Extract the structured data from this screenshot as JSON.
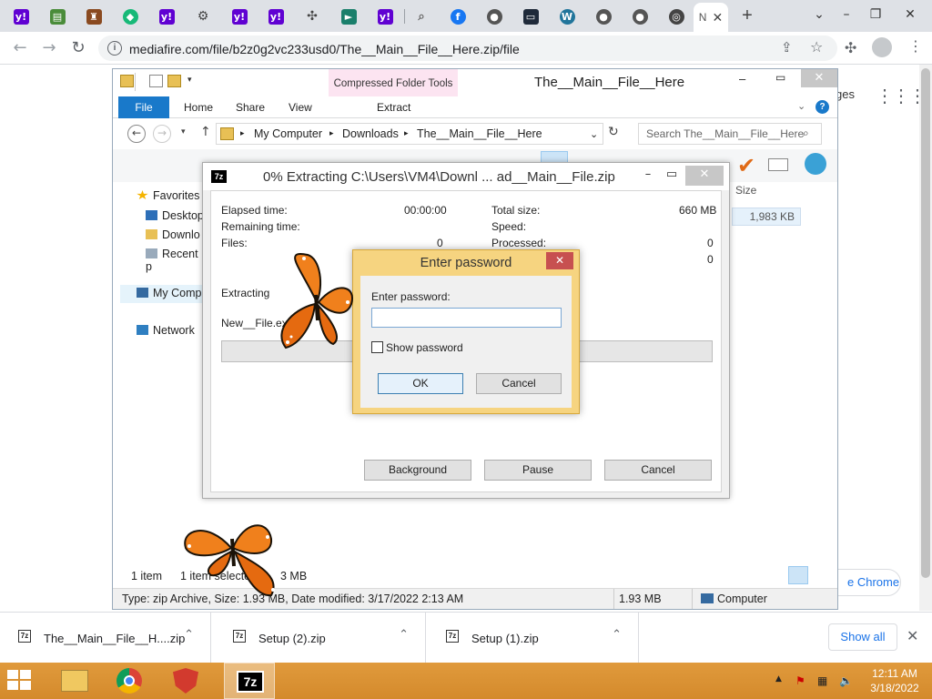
{
  "browser": {
    "tab_icons": [
      "yahoo-icon",
      "game-icon",
      "game2-icon",
      "diamond-icon",
      "yahoo-icon",
      "gear-icon",
      "yahoo-icon",
      "yahoo-icon",
      "puzzle-icon",
      "arrow-icon",
      "yahoo-icon",
      "search-icon",
      "facebook-icon",
      "globe-icon",
      "terminal-icon",
      "wordpress-icon",
      "globe-icon",
      "globe-icon",
      "chrome-icon"
    ],
    "active_tab_label": "N",
    "url": "mediafire.com/file/b2z0g2vc233usd0/The__Main__File__Here.zip/file"
  },
  "page": {
    "partial_text": "ges",
    "chrome_button": "e Chrome"
  },
  "explorer": {
    "title": "The__Main__File__Here",
    "contextual_tab": "Compressed Folder Tools",
    "tabs": [
      "File",
      "Home",
      "Share",
      "View",
      "Extract"
    ],
    "breadcrumb": [
      "My Computer",
      "Downloads",
      "The__Main__File__Here"
    ],
    "search_placeholder": "Search The__Main__File__Here",
    "nav": [
      "Favorites",
      "Desktop",
      "Downlo",
      "Recent p",
      "My Comp",
      "Network"
    ],
    "column_size": "Size",
    "size_value": "1,983 KB",
    "status_count": "1 item",
    "status_selected": "1 item selecte",
    "status_size": "3 MB",
    "details": "Type: zip Archive, Size: 1.93 MB, Date modified: 3/17/2022 2:13 AM",
    "details_size": "1.93 MB",
    "details_location": "Computer"
  },
  "progress": {
    "title": "0% Extracting C:\\Users\\VM4\\Downl ... ad__Main__File.zip",
    "elapsed_label": "Elapsed time:",
    "elapsed_value": "00:00:00",
    "remaining_label": "Remaining time:",
    "files_label": "Files:",
    "files_value": "0",
    "total_size_label": "Total size:",
    "total_size_value": "660 MB",
    "speed_label": "Speed:",
    "processed_label": "Processed:",
    "processed_value": "0",
    "extra_value": "0",
    "extracting_label": "Extracting",
    "current_file": "New__File.exe",
    "percent": 0,
    "background_button": "Background",
    "pause_button": "Pause",
    "cancel_button": "Cancel"
  },
  "password_dialog": {
    "title": "Enter password",
    "label": "Enter password:",
    "value": "",
    "show_password_label": "Show password",
    "show_password_checked": false,
    "ok_button": "OK",
    "cancel_button": "Cancel"
  },
  "downloads": {
    "items": [
      "The__Main__File__H....zip",
      "Setup (2).zip",
      "Setup (1).zip"
    ],
    "show_all": "Show all"
  },
  "taskbar": {
    "time": "12:11 AM",
    "date": "3/18/2022"
  },
  "colors": {
    "taskbar": "#d8902f",
    "accent": "#1979ca",
    "password_frame": "#f6d480"
  }
}
